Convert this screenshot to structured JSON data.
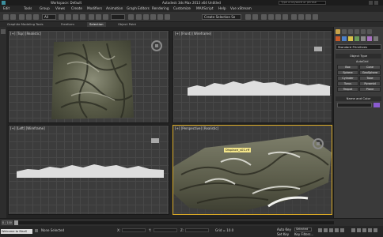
{
  "app": {
    "title": "Autodesk 3ds Max 2013 x64   Untitled",
    "workspace": "Workspace: Default",
    "search_placeholder": "Type a keyword or phrase"
  },
  "menu": [
    "Edit",
    "Tools",
    "Group",
    "Views",
    "Create",
    "Modifiers",
    "Animation",
    "Graph Editors",
    "Rendering",
    "Customize",
    "MAXScript",
    "Help",
    "Vue xStream"
  ],
  "toolbar": {
    "filter_value": "All",
    "selection_set": "Create Selection Se"
  },
  "ribbon_tabs": [
    {
      "label": "Graphite Modeling Tools",
      "active": false
    },
    {
      "label": "Freeform",
      "active": false
    },
    {
      "label": "Selection",
      "active": true
    },
    {
      "label": "Object Paint",
      "active": false
    }
  ],
  "viewports": {
    "top": "[+] [Top] [Realistic]",
    "front": "[+] [Front] [Wireframe]",
    "left": "[+] [Left] [Wireframe]",
    "perspective": "[+] [Perspective] [Realistic]",
    "tooltip": "Displace_s01.rff"
  },
  "command_panel": {
    "category": "Standard Primitives",
    "rollout_object_type": "Object Type",
    "autogrid": "AutoGrid",
    "buttons": [
      "Box",
      "Cone",
      "Sphere",
      "GeoSphere",
      "Cylinder",
      "Tube",
      "Torus",
      "Pyramid",
      "Teapot",
      "Plane"
    ],
    "rollout_name_color": "Name and Color"
  },
  "timeline": {
    "frame_readout": "0 / 100"
  },
  "status": {
    "welcome": "Welcome to MaxS",
    "selection": "None Selected",
    "x_label": "X:",
    "y_label": "Y:",
    "z_label": "Z:",
    "grid": "Grid = 10.0",
    "autokey": "Auto Key",
    "set_key": "Set Key",
    "selected_filter": "Selected",
    "key_filters": "Key Filters..."
  },
  "colors": {
    "active_viewport_border": "#d9a926",
    "tooltip_bg": "#f3e58a",
    "terrain": "#6b6c58"
  }
}
